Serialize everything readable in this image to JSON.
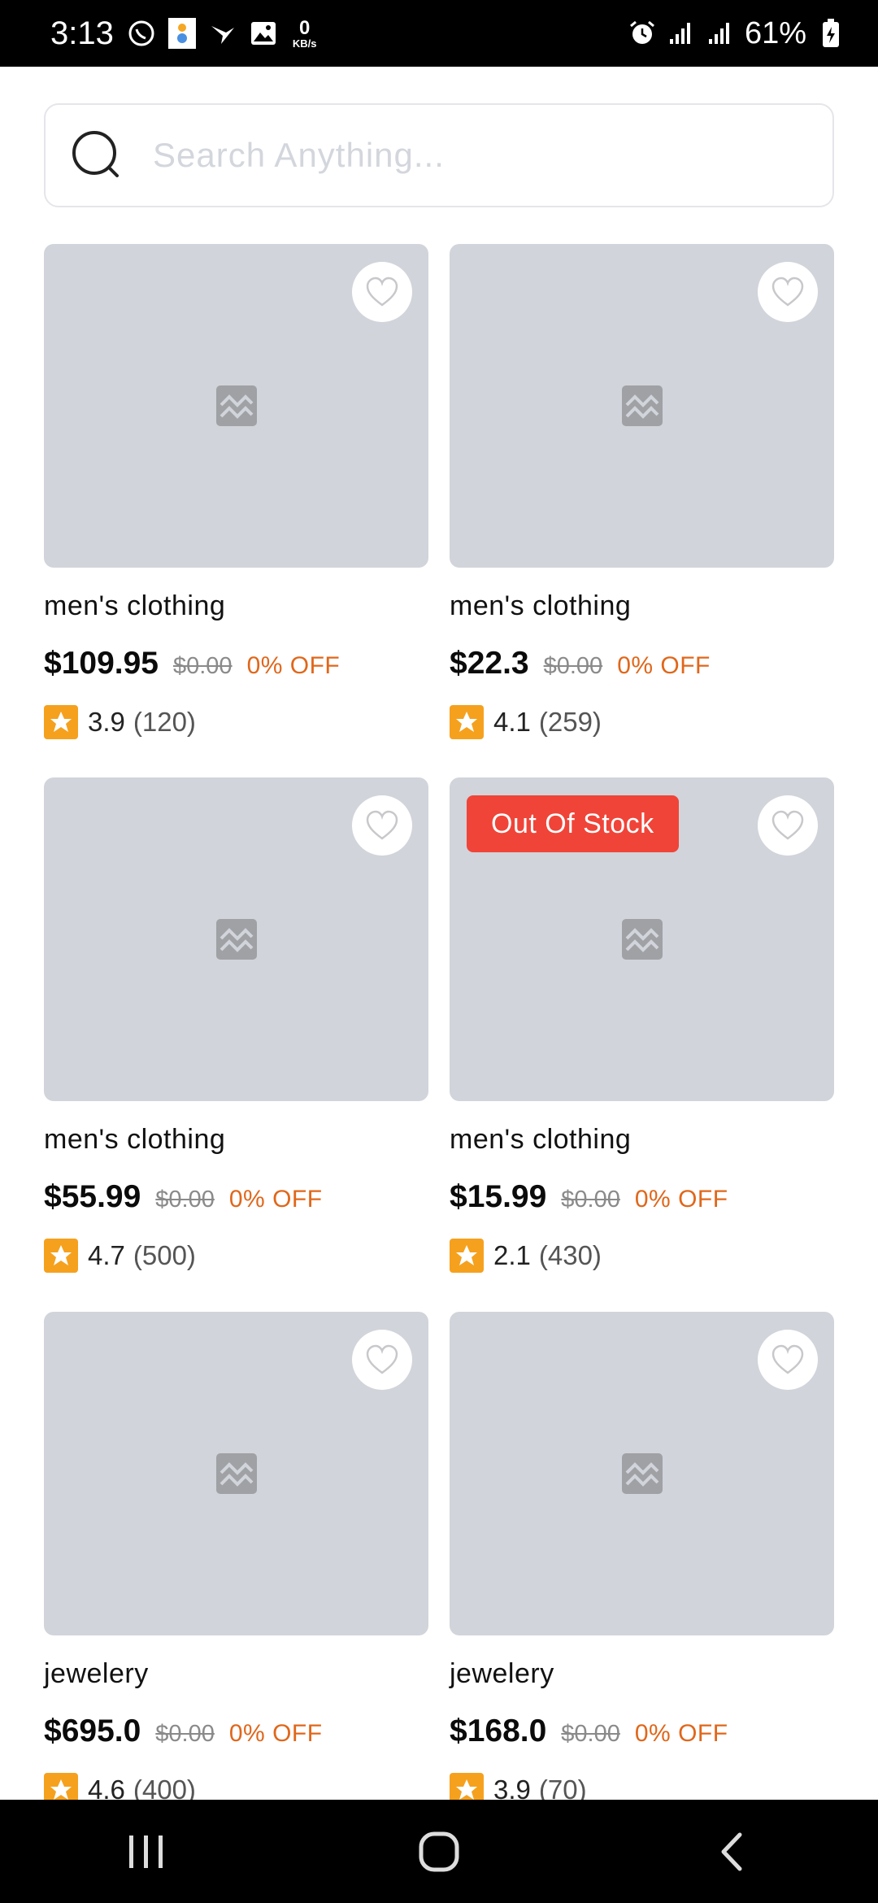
{
  "status_bar": {
    "time": "3:13",
    "net_speed_value": "0",
    "net_speed_unit": "KB/s",
    "battery": "61%"
  },
  "search": {
    "placeholder": "Search Anything..."
  },
  "products": [
    {
      "category": "men's clothing",
      "price": "$109.95",
      "old_price": "$0.00",
      "discount": "0% OFF",
      "rating": "3.9",
      "reviews": "(120)",
      "badge": ""
    },
    {
      "category": "men's clothing",
      "price": "$22.3",
      "old_price": "$0.00",
      "discount": "0% OFF",
      "rating": "4.1",
      "reviews": "(259)",
      "badge": ""
    },
    {
      "category": "men's clothing",
      "price": "$55.99",
      "old_price": "$0.00",
      "discount": "0% OFF",
      "rating": "4.7",
      "reviews": "(500)",
      "badge": ""
    },
    {
      "category": "men's clothing",
      "price": "$15.99",
      "old_price": "$0.00",
      "discount": "0% OFF",
      "rating": "2.1",
      "reviews": "(430)",
      "badge": "Out Of Stock"
    },
    {
      "category": "jewelery",
      "price": "$695.0",
      "old_price": "$0.00",
      "discount": "0% OFF",
      "rating": "4.6",
      "reviews": "(400)",
      "badge": ""
    },
    {
      "category": "jewelery",
      "price": "$168.0",
      "old_price": "$0.00",
      "discount": "0% OFF",
      "rating": "3.9",
      "reviews": "(70)",
      "badge": ""
    }
  ],
  "colors": {
    "accent_discount": "#e0671b",
    "star_bg": "#f5a11e",
    "badge_bg": "#f04438",
    "image_placeholder": "#d1d4da"
  }
}
